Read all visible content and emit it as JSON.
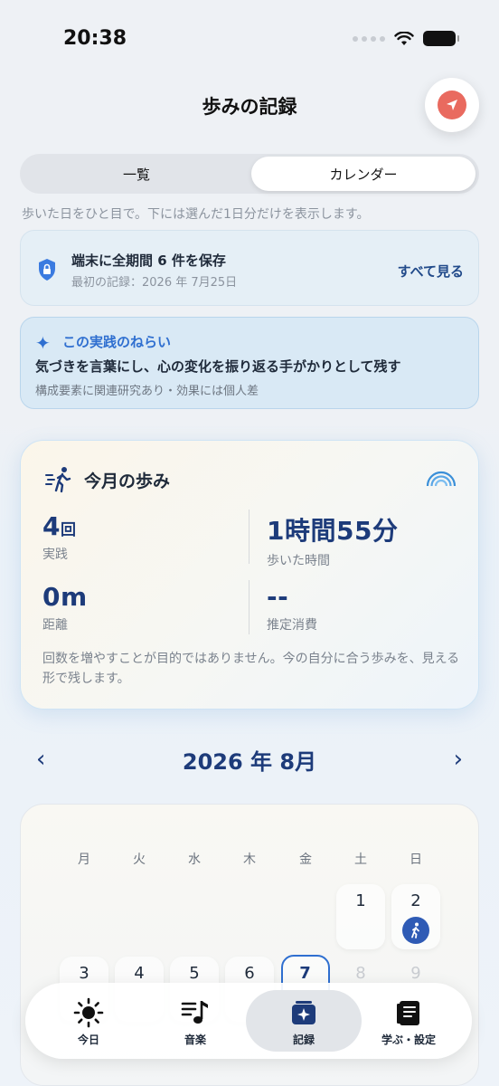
{
  "status_bar": {
    "time": "20:38"
  },
  "header": {
    "title": "歩みの記録"
  },
  "segmented": {
    "list_label": "一覧",
    "calendar_label": "カレンダー"
  },
  "subtitle": "歩いた日をひと目で。下には選んだ1日分だけを表示します。",
  "storage": {
    "title": "端末に全期間 6 件を保存",
    "subtitle": "最初の記録：2026 年 7月25日",
    "see_all": "すべて見る"
  },
  "aim": {
    "title": "この実践のねらい",
    "body": "気づきを言葉にし、心の変化を振り返る手がかりとして残す",
    "note": "構成要素に関連研究あり・効果には個人差"
  },
  "month_summary": {
    "title": "今月の歩み",
    "sessions_value": "4",
    "sessions_unit": "回",
    "sessions_label": "実践",
    "time_value": "1時間55分",
    "time_label": "歩いた時間",
    "distance_value": "0m",
    "distance_label": "距離",
    "energy_value": "--",
    "energy_label": "推定消費",
    "note": "回数を増やすことが目的ではありません。今の自分に合う歩みを、見える形で残します。"
  },
  "calendar": {
    "title": "2026 年 8月",
    "prev": "‹",
    "next": "›",
    "weekdays": [
      "月",
      "火",
      "水",
      "木",
      "金",
      "土",
      "日"
    ],
    "days": [
      "1",
      "2",
      "3",
      "4",
      "5",
      "6",
      "7",
      "8",
      "9"
    ],
    "walked_days": [
      "2"
    ],
    "selected_day": "7"
  },
  "tabs": [
    {
      "label": "今日",
      "icon": "sun-icon"
    },
    {
      "label": "音楽",
      "icon": "music-icon"
    },
    {
      "label": "記録",
      "icon": "sparkle-record-icon",
      "active": true
    },
    {
      "label": "学ぶ・設定",
      "icon": "book-icon"
    }
  ]
}
